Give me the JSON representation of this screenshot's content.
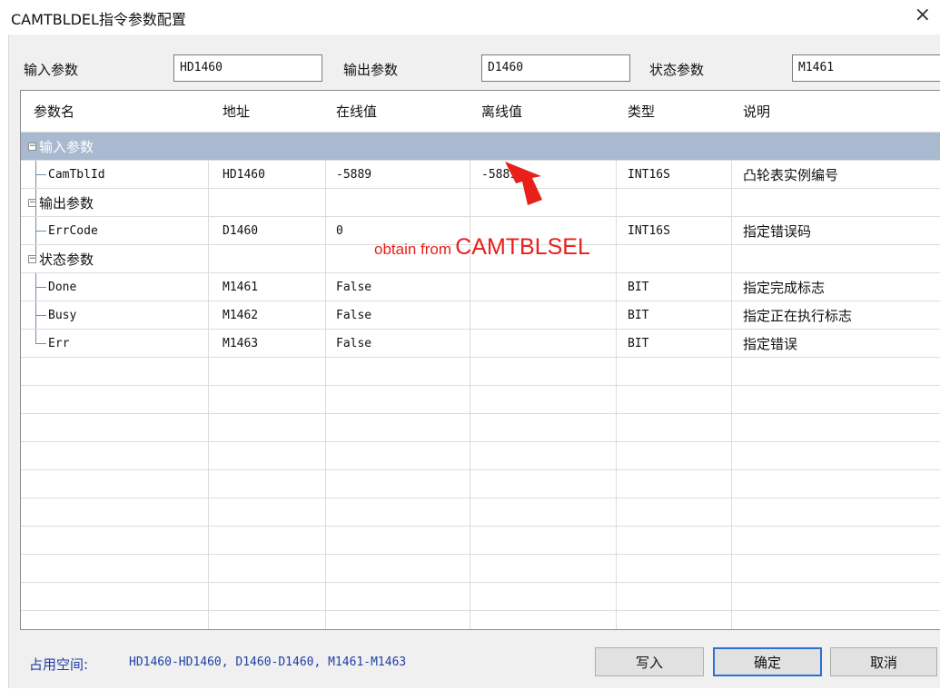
{
  "window": {
    "title": "CAMTBLDEL指令参数配置",
    "close_glyph": "×"
  },
  "params": {
    "input_label": "输入参数",
    "input_value": "HD1460",
    "output_label": "输出参数",
    "output_value": "D1460",
    "status_label": "状态参数",
    "status_value": "M1461"
  },
  "table": {
    "headers": [
      "参数名",
      "地址",
      "在线值",
      "离线值",
      "类型",
      "说明"
    ],
    "groups": {
      "input": "输入参数",
      "output": "输出参数",
      "status": "状态参数"
    },
    "rows": [
      {
        "name": "CamTblId",
        "address": "HD1460",
        "online": "-5889",
        "offline": "-5889",
        "type": "INT16S",
        "desc": "凸轮表实例编号"
      },
      {
        "name": "ErrCode",
        "address": "D1460",
        "online": "0",
        "offline": "",
        "type": "INT16S",
        "desc": "指定错误码"
      },
      {
        "name": "Done",
        "address": "M1461",
        "online": "False",
        "offline": "",
        "type": "BIT",
        "desc": "指定完成标志"
      },
      {
        "name": "Busy",
        "address": "M1462",
        "online": "False",
        "offline": "",
        "type": "BIT",
        "desc": "指定正在执行标志"
      },
      {
        "name": "Err",
        "address": "M1463",
        "online": "False",
        "offline": "",
        "type": "BIT",
        "desc": "指定错误"
      }
    ]
  },
  "annotation": {
    "prefix": "obtain from",
    "highlight": "CAMTBLSEL",
    "color": "#e8201a"
  },
  "footer": {
    "occupied_label": "占用空间:",
    "occupied_value": "HD1460-HD1460, D1460-D1460, M1461-M1463",
    "write_label": "写入",
    "ok_label": "确定",
    "cancel_label": "取消"
  },
  "colors": {
    "selected_row": "#a8b9d0",
    "link_blue": "#1f3fa3",
    "default_button_border": "#2c6fd6"
  }
}
